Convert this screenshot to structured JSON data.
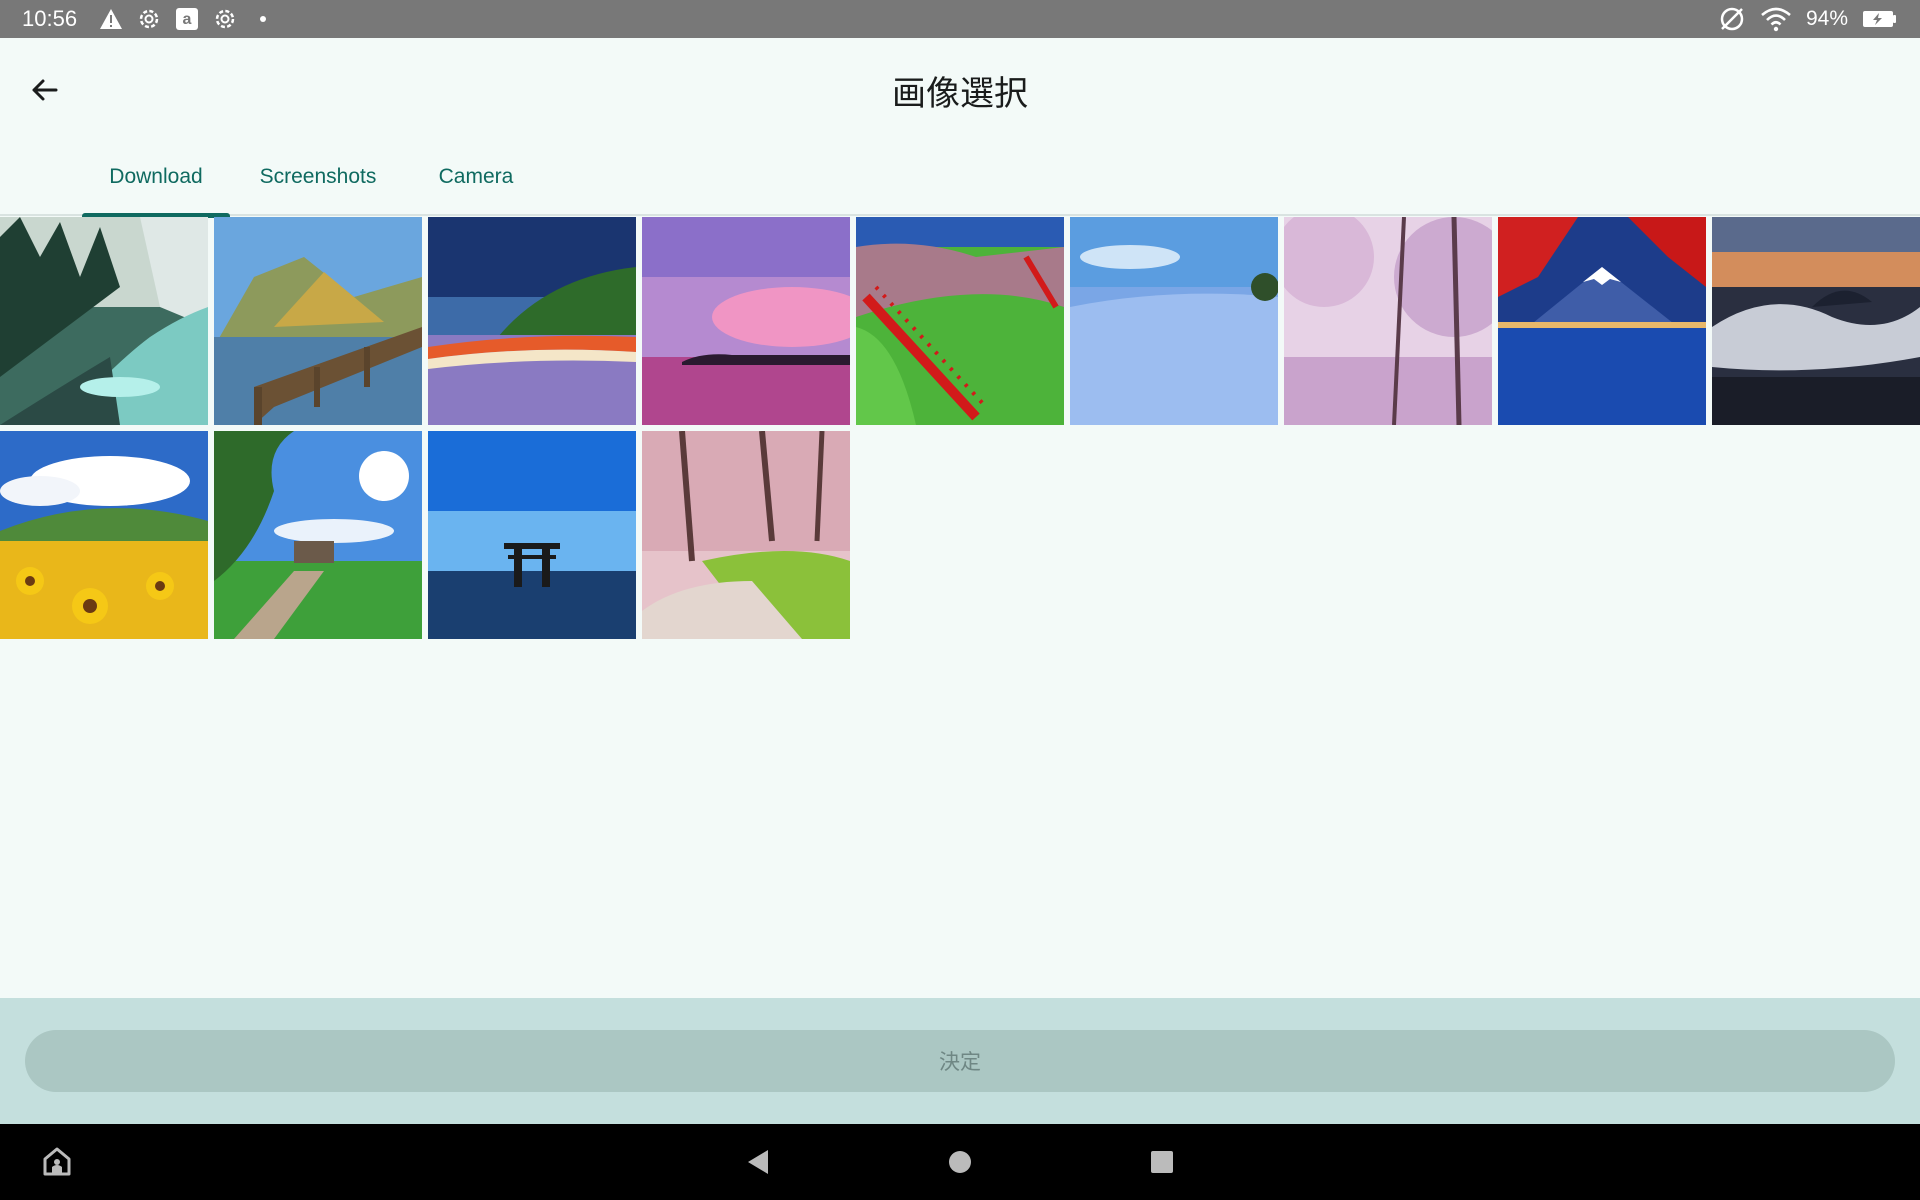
{
  "status_bar": {
    "time": "10:56",
    "battery": "94%",
    "left_icons": [
      "alert-icon",
      "settings-icon",
      "amazon-icon",
      "settings-icon",
      "dot-icon"
    ],
    "right_icons": [
      "no-sync-icon",
      "wifi-icon",
      "battery-charging-icon"
    ]
  },
  "app_bar": {
    "title": "画像選択",
    "back_icon": "arrow-left-icon"
  },
  "tabs": [
    {
      "label": "Download",
      "active": true
    },
    {
      "label": "Screenshots",
      "active": false
    },
    {
      "label": "Camera",
      "active": false
    }
  ],
  "images": [
    {
      "name": "forest-stream"
    },
    {
      "name": "lake-fence-mountain"
    },
    {
      "name": "flower-field-night"
    },
    {
      "name": "pink-sunset-sea"
    },
    {
      "name": "red-torii-path"
    },
    {
      "name": "nemophila-field"
    },
    {
      "name": "cherry-blossom-tunnel"
    },
    {
      "name": "mount-fuji-autumn"
    },
    {
      "name": "sea-of-clouds"
    },
    {
      "name": "sunflower-field"
    },
    {
      "name": "countryside-road"
    },
    {
      "name": "torii-in-sea"
    },
    {
      "name": "cherry-tree-path"
    }
  ],
  "confirm_button": {
    "label": "決定"
  },
  "nav_bar": {
    "icons": [
      "home-app-icon",
      "back-triangle-icon",
      "home-circle-icon",
      "recents-square-icon"
    ]
  },
  "colors": {
    "accent": "#0f6a60",
    "background": "#f3faf8",
    "bottom_area": "#c4dfdd",
    "confirm_button": "#abc7c3"
  }
}
